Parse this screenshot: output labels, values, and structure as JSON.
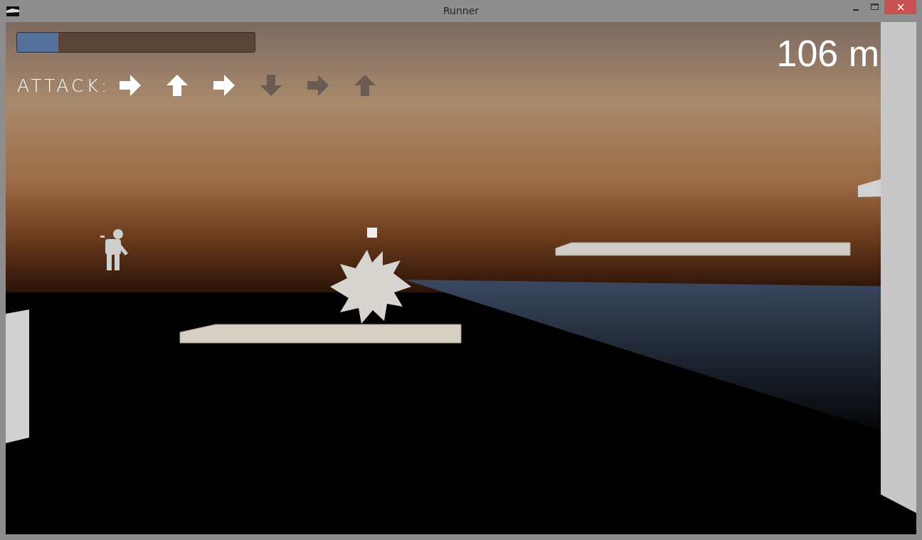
{
  "window": {
    "title": "Runner"
  },
  "hud": {
    "health": {
      "level": 0.175
    },
    "distance": "106 m",
    "attack": {
      "label": "ATTACK:",
      "arrows": [
        {
          "kind": "right",
          "done": true
        },
        {
          "kind": "up",
          "done": true
        },
        {
          "kind": "right",
          "done": true
        },
        {
          "kind": "down",
          "done": false
        },
        {
          "kind": "right",
          "done": false
        },
        {
          "kind": "up",
          "done": false
        }
      ]
    }
  }
}
